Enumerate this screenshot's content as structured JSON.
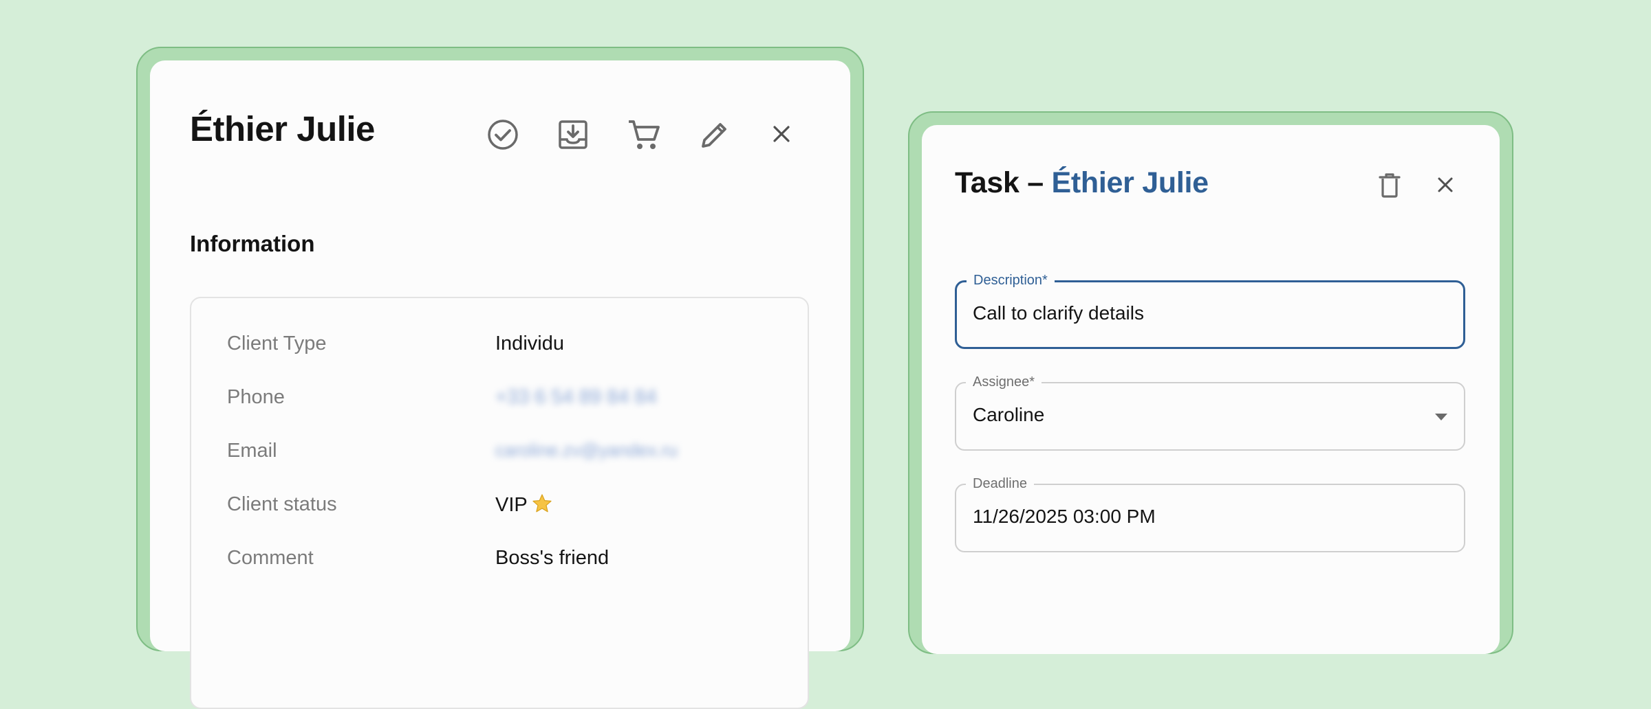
{
  "client_panel": {
    "title": "Éthier Julie",
    "actions": [
      {
        "name": "check-circle",
        "label": "Complete"
      },
      {
        "name": "archive-download",
        "label": "Archive"
      },
      {
        "name": "cart",
        "label": "Order"
      },
      {
        "name": "edit",
        "label": "Edit"
      },
      {
        "name": "close",
        "label": "Close"
      }
    ],
    "section_title": "Information",
    "fields": [
      {
        "label": "Client Type",
        "value": "Individu"
      },
      {
        "label": "Phone",
        "value": "+33 6 54 89 84 84",
        "blurred": true
      },
      {
        "label": "Email",
        "value": "caroline.zv@yandex.ru",
        "blurred": true
      },
      {
        "label": "Client status",
        "value": "VIP"
      },
      {
        "label": "Comment",
        "value": "Boss's friend"
      }
    ]
  },
  "task_panel": {
    "title_prefix": "Task – ",
    "title_client": "Éthier Julie",
    "description": {
      "label": "Description*",
      "value": "Call to clarify details"
    },
    "assignee": {
      "label": "Assignee*",
      "value": "Caroline"
    },
    "deadline": {
      "label": "Deadline",
      "value": "11/26/2025 03:00 PM"
    }
  },
  "colors": {
    "background": "#d5eed8",
    "frame": "#afdcb2",
    "accent": "#2f5f95",
    "star": "#f6c343"
  }
}
